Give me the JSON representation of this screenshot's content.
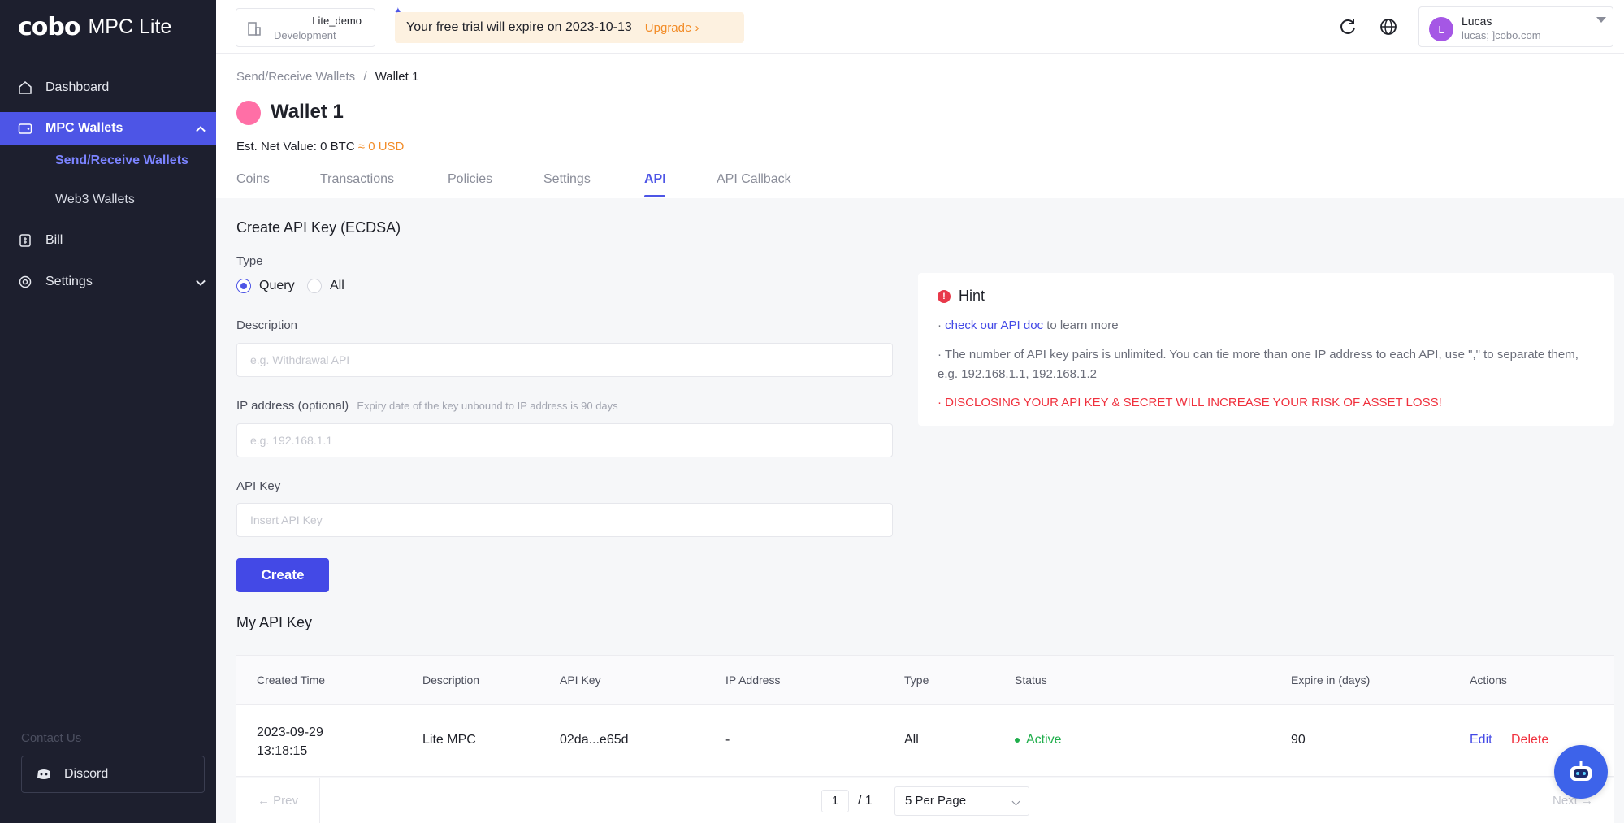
{
  "sidebar": {
    "logo_mark": "cobo",
    "logo_text": "MPC Lite",
    "items": [
      {
        "label": "Dashboard"
      },
      {
        "label": "MPC Wallets"
      },
      {
        "label": "Bill"
      },
      {
        "label": "Settings"
      }
    ],
    "sub_items": [
      {
        "label": "Send/Receive Wallets"
      },
      {
        "label": "Web3 Wallets"
      }
    ],
    "contact_label": "Contact Us",
    "discord_label": "Discord"
  },
  "topbar": {
    "org_name": "Lite_demo",
    "org_env": "Development",
    "trial_text": "Your free trial will expire on 2023-10-13",
    "upgrade_label": "Upgrade ›",
    "user_initial": "L",
    "user_name": "Lucas",
    "user_email": "lucas;           ]cobo.com"
  },
  "header": {
    "breadcrumb_parent": "Send/Receive Wallets",
    "breadcrumb_sep": "/",
    "breadcrumb_current": "Wallet 1",
    "wallet_title": "Wallet 1",
    "net_value_label": "Est. Net Value: 0 BTC",
    "net_value_usd": "≈ 0 USD",
    "tabs": [
      {
        "label": "Coins"
      },
      {
        "label": "Transactions"
      },
      {
        "label": "Policies"
      },
      {
        "label": "Settings"
      },
      {
        "label": "API"
      },
      {
        "label": "API Callback"
      }
    ]
  },
  "form": {
    "title": "Create API Key (ECDSA)",
    "type_label": "Type",
    "type_options": [
      {
        "label": "Query"
      },
      {
        "label": "All"
      }
    ],
    "description_label": "Description",
    "description_placeholder": "e.g. Withdrawal API",
    "ip_label": "IP address (optional)",
    "ip_hint": "Expiry date of the key unbound to IP address is 90 days",
    "ip_placeholder": "e.g. 192.168.1.1",
    "api_key_label": "API Key",
    "api_key_placeholder": "Insert API Key",
    "create_label": "Create"
  },
  "hint": {
    "title": "Hint",
    "line1_link": "check our API doc",
    "line1_rest": "to learn more",
    "line2": "· The number of API key pairs is unlimited. You can tie more than one IP address to each API, use \",\" to separate them, e.g. 192.168.1.1, 192.168.1.2",
    "line3": "· DISCLOSING YOUR API KEY & SECRET WILL INCREASE YOUR RISK OF ASSET LOSS!"
  },
  "table": {
    "title": "My API Key",
    "headers": [
      "Created Time",
      "Description",
      "API Key",
      "IP Address",
      "Type",
      "Status",
      "Expire in (days)",
      "Actions"
    ],
    "rows": [
      {
        "created_date": "2023-09-29",
        "created_time": "13:18:15",
        "description": "Lite MPC",
        "api_key": "02da...e65d",
        "ip": "-",
        "type": "All",
        "status": "Active",
        "expire": "90",
        "edit": "Edit",
        "delete": "Delete"
      }
    ]
  },
  "pager": {
    "prev": "← Prev",
    "next": "Next →",
    "page": "1",
    "total": "/ 1",
    "per_page": "5 Per Page"
  }
}
